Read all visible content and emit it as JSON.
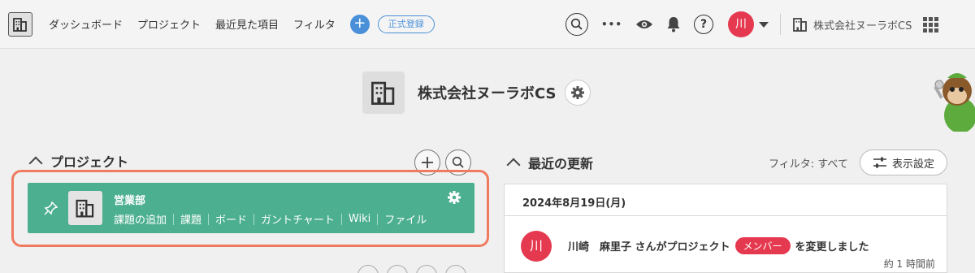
{
  "nav": {
    "items": [
      "ダッシュボード",
      "プロジェクト",
      "最近見た項目",
      "フィルタ"
    ],
    "add_label": "+",
    "register_label": "正式登録",
    "more_label": "•••",
    "user_initial": "川",
    "space_name": "株式会社ヌーラボCS"
  },
  "space": {
    "title": "株式会社ヌーラボCS"
  },
  "projects": {
    "title": "プロジェクト",
    "card": {
      "name": "営業部",
      "links": [
        "課題の追加",
        "課題",
        "ボード",
        "ガントチャート",
        "Wiki",
        "ファイル"
      ]
    }
  },
  "updates": {
    "title": "最近の更新",
    "filter": "フィルタ: すべて",
    "display_settings": "表示設定",
    "date": "2024年8月19日(月)",
    "item": {
      "avatar_initial": "川",
      "user": "川崎　麻里子 さんがプロジェクト",
      "role": "メンバー",
      "action": "を変更しました",
      "time": "約 1 時間前"
    }
  },
  "colors": {
    "accent": "#4caf8f",
    "highlight": "#f07a5f",
    "avatar": "#e53950",
    "link": "#4a90d9"
  },
  "icons": [
    "building-icon",
    "search-icon",
    "eye-icon",
    "bell-icon",
    "help-icon",
    "apps-grid-icon",
    "gear-icon",
    "pin-icon",
    "plus-icon",
    "filter-settings-icon",
    "chevron-up-icon"
  ]
}
